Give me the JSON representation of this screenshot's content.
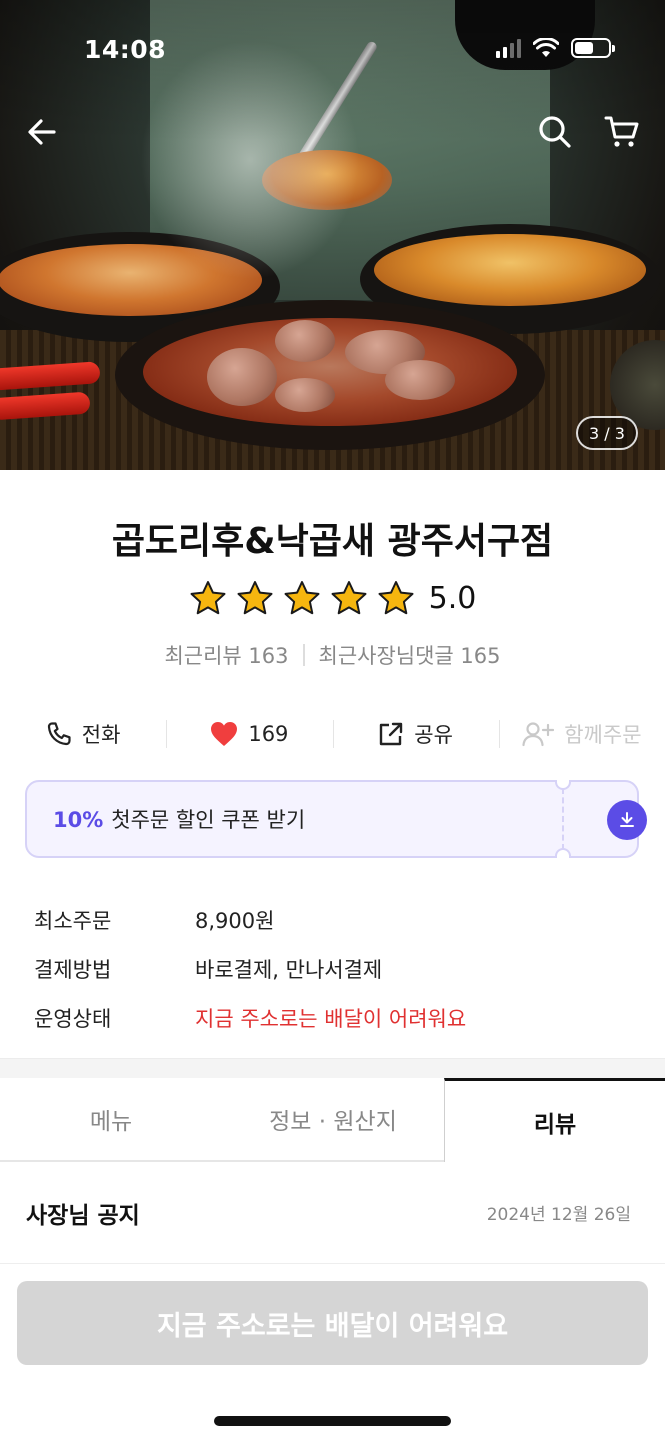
{
  "status_bar": {
    "time": "14:08"
  },
  "hero": {
    "page_indicator": "3 / 3"
  },
  "store": {
    "name": "곱도리후&낙곱새 광주서구점",
    "rating_value": "5.0",
    "rating_stars": 5,
    "recent_reviews": "최근리뷰 163",
    "owner_replies": "최근사장님댓글 165"
  },
  "actions": {
    "call": "전화",
    "like_count": "169",
    "share": "공유",
    "group_order": "함께주문"
  },
  "coupon": {
    "percent": "10%",
    "label": "첫주문 할인 쿠폰 받기"
  },
  "info": [
    {
      "key": "최소주문",
      "value": "8,900원",
      "alert": false
    },
    {
      "key": "결제방법",
      "value": "바로결제, 만나서결제",
      "alert": false
    },
    {
      "key": "운영상태",
      "value": "지금 주소로는 배달이 어려워요",
      "alert": true
    }
  ],
  "tabs": [
    "메뉴",
    "정보 · 원산지",
    "리뷰"
  ],
  "active_tab": "리뷰",
  "notice": {
    "title": "사장님 공지",
    "date": "2024년 12월 26일"
  },
  "cta": {
    "label": "지금 주소로는 배달이 어려워요"
  },
  "colors": {
    "accent": "#5b4ce6",
    "alert": "#e03131",
    "heart": "#f03e3e",
    "star": "#f6b60f"
  },
  "icons": [
    "back-arrow-icon",
    "search-icon",
    "cart-icon",
    "phone-icon",
    "heart-icon",
    "share-icon",
    "add-person-icon",
    "download-icon",
    "star-icon"
  ]
}
